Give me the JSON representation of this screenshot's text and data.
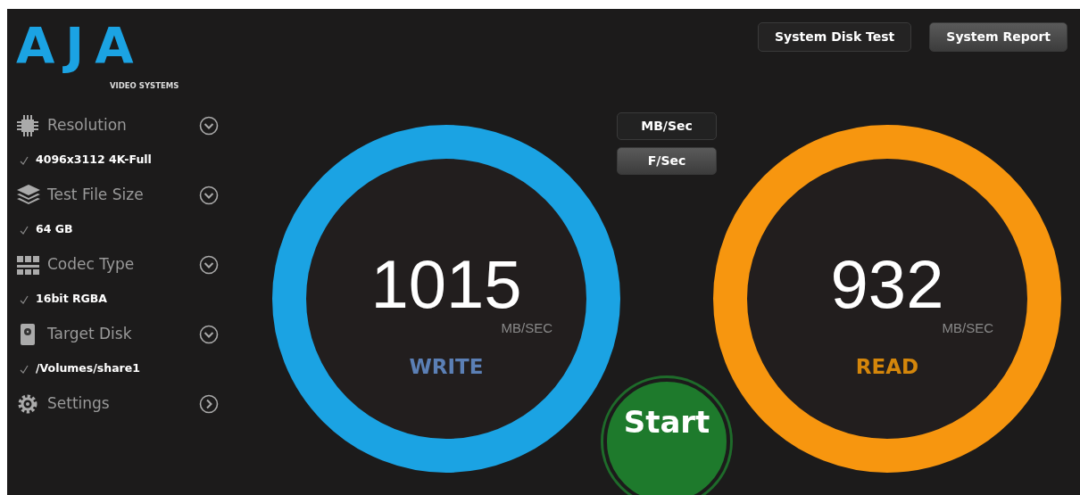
{
  "logo": {
    "wordmark": "AJA",
    "tagline": "VIDEO SYSTEMS"
  },
  "sidebar": {
    "items": [
      {
        "kind": "resolution",
        "label": "Resolution",
        "expanded": true,
        "value": "4096x3112 4K-Full"
      },
      {
        "kind": "file-size",
        "label": "Test File Size",
        "expanded": true,
        "value": "64 GB"
      },
      {
        "kind": "codec",
        "label": "Codec Type",
        "expanded": true,
        "value": "16bit RGBA"
      },
      {
        "kind": "disk",
        "label": "Target Disk",
        "expanded": true,
        "value": "/Volumes/share1"
      },
      {
        "kind": "settings",
        "label": "Settings",
        "expanded": false
      }
    ]
  },
  "toolbar": {
    "buttons": [
      "System Disk Test",
      "System Report"
    ]
  },
  "units": [
    {
      "label": "MB/Sec",
      "selected": true
    },
    {
      "label": "F/Sec",
      "selected": false
    }
  ],
  "gauges": [
    {
      "kind": "write",
      "value": "1015",
      "unit": "MB/SEC",
      "label": "WRITE",
      "color": "#1ba3e3"
    },
    {
      "kind": "read",
      "value": "932",
      "unit": "MB/SEC",
      "label": "READ",
      "color": "#f7960f"
    }
  ],
  "start_button": "Start"
}
